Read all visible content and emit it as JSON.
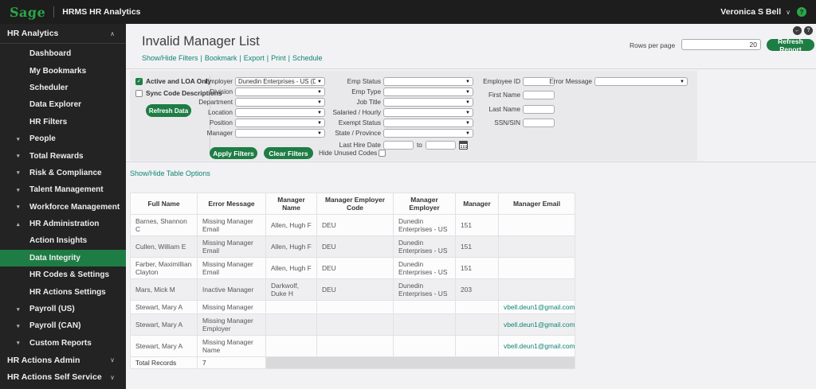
{
  "topbar": {
    "logo": "Sage",
    "app_title": "HRMS HR Analytics",
    "user_name": "Veronica S Bell",
    "help": "?"
  },
  "sidebar": {
    "section_header": "HR Analytics",
    "items": [
      {
        "label": "Dashboard",
        "type": "link"
      },
      {
        "label": "My Bookmarks",
        "type": "link"
      },
      {
        "label": "Scheduler",
        "type": "link"
      },
      {
        "label": "Data Explorer",
        "type": "link"
      },
      {
        "label": "HR Filters",
        "type": "link"
      },
      {
        "label": "People",
        "type": "group",
        "state": "collapsed"
      },
      {
        "label": "Total Rewards",
        "type": "group",
        "state": "collapsed"
      },
      {
        "label": "Risk & Compliance",
        "type": "group",
        "state": "collapsed"
      },
      {
        "label": "Talent Management",
        "type": "group",
        "state": "collapsed"
      },
      {
        "label": "Workforce Management",
        "type": "group",
        "state": "collapsed"
      },
      {
        "label": "HR Administration",
        "type": "group",
        "state": "expanded"
      },
      {
        "label": "Action Insights",
        "type": "link"
      },
      {
        "label": "Data Integrity",
        "type": "link",
        "selected": true
      },
      {
        "label": "HR Codes & Settings",
        "type": "link"
      },
      {
        "label": "HR Actions Settings",
        "type": "link"
      },
      {
        "label": "Payroll (US)",
        "type": "group",
        "state": "collapsed"
      },
      {
        "label": "Payroll (CAN)",
        "type": "group",
        "state": "collapsed"
      },
      {
        "label": "Custom Reports",
        "type": "group",
        "state": "collapsed"
      }
    ],
    "bottom_sections": [
      {
        "label": "HR Actions Admin"
      },
      {
        "label": "HR Actions Self Service"
      }
    ]
  },
  "header": {
    "title": "Invalid Manager List",
    "links": [
      "Show/Hide Filters",
      "Bookmark",
      "Export",
      "Print",
      "Schedule"
    ],
    "rows_per_page_label": "Rows per page",
    "rows_per_page_value": "20",
    "refresh_report_label": "Refresh Report",
    "back_icon": "←",
    "help_icon": "?"
  },
  "filters": {
    "checkboxes": [
      {
        "label": "Active and LOA Only",
        "checked": true
      },
      {
        "label": "Sync Code Descriptions",
        "checked": false
      }
    ],
    "refresh_data_label": "Refresh Data",
    "col1": [
      {
        "label": "Employer",
        "value": "Dunedin Enterprises - US (DEU)"
      },
      {
        "label": "Division",
        "value": ""
      },
      {
        "label": "Department",
        "value": ""
      },
      {
        "label": "Location",
        "value": ""
      },
      {
        "label": "Position",
        "value": ""
      },
      {
        "label": "Manager",
        "value": ""
      }
    ],
    "col2": [
      {
        "label": "Emp Status",
        "value": ""
      },
      {
        "label": "Emp Type",
        "value": ""
      },
      {
        "label": "Job Title",
        "value": ""
      },
      {
        "label": "Salaried / Hourly",
        "value": ""
      },
      {
        "label": "Exempt Status",
        "value": ""
      },
      {
        "label": "State / Province",
        "value": ""
      }
    ],
    "col3": [
      {
        "label": "Employee ID",
        "value": ""
      },
      {
        "label": "First Name",
        "value": ""
      },
      {
        "label": "Last Name",
        "value": ""
      },
      {
        "label": "SSN/SIN",
        "value": ""
      }
    ],
    "error_message": {
      "label": "Error Message",
      "value": ""
    },
    "last_hire_date": {
      "label": "Last Hire Date",
      "from": "",
      "to_label": "to",
      "to": ""
    },
    "apply_label": "Apply Filters",
    "clear_label": "Clear Filters",
    "hide_unused_label": "Hide Unused Codes",
    "hide_unused_checked": false
  },
  "table_options_link": "Show/Hide Table Options",
  "table": {
    "columns": [
      "Full Name",
      "Error Message",
      "Manager Name",
      "Manager Employer Code",
      "Manager Employer",
      "Manager",
      "Manager Email"
    ],
    "rows": [
      [
        "Barnes, Shannon C",
        "Missing Manager Email",
        "Allen, Hugh F",
        "DEU",
        "Dunedin Enterprises - US",
        "151",
        ""
      ],
      [
        "Cullen, William E",
        "Missing Manager Email",
        "Allen, Hugh F",
        "DEU",
        "Dunedin Enterprises - US",
        "151",
        ""
      ],
      [
        "Farber, Maximillian Clayton",
        "Missing Manager Email",
        "Allen, Hugh F",
        "DEU",
        "Dunedin Enterprises - US",
        "151",
        ""
      ],
      [
        "Mars, Mick M",
        "Inactive Manager",
        "Darkwolf, Duke H",
        "DEU",
        "Dunedin Enterprises - US",
        "203",
        ""
      ],
      [
        "Stewart, Mary A",
        "Missing Manager",
        "",
        "",
        "",
        "",
        "vbell.deun1@gmail.com"
      ],
      [
        "Stewart, Mary A",
        "Missing Manager Employer",
        "",
        "",
        "",
        "",
        "vbell.deun1@gmail.com"
      ],
      [
        "Stewart, Mary A",
        "Missing Manager Name",
        "",
        "",
        "",
        "",
        "vbell.deun1@gmail.com"
      ]
    ],
    "footer": {
      "label": "Total Records",
      "value": "7"
    }
  },
  "colors": {
    "brand_green": "#2aa747",
    "button_green": "#1e7d44",
    "selected_green": "#1e7d44",
    "link_teal": "#0f8573",
    "topbar_black": "#1d1d1d",
    "sidebar_dark": "#232323"
  }
}
